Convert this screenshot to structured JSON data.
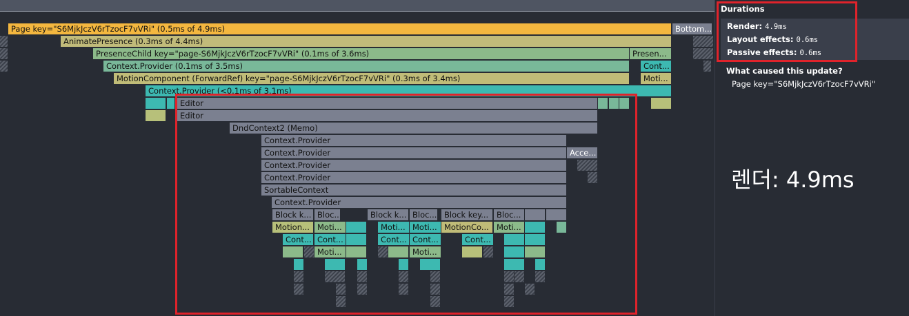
{
  "flamegraph": {
    "rows": [
      [
        {
          "label": "Page key=\"S6MjkJczV6rTzocF7vVRi\" (0.5ms of 4.9ms)",
          "color": "#f4b73f"
        },
        {
          "label": "Bottom...",
          "color": "#7b8090"
        }
      ],
      [
        {
          "label": "AnimatePresence (0.3ms of 4.4ms)",
          "color": "#c1bb7a"
        }
      ],
      [
        {
          "label": "PresenceChild key=\"page-S6MjkJczV6rTzocF7vVRi\" (0.1ms of 3.6ms)",
          "color": "#8cba8a"
        },
        {
          "label": "Presen...",
          "color": "#8cba8a"
        }
      ],
      [
        {
          "label": "Context.Provider (0.1ms of 3.5ms)",
          "color": "#79b899"
        },
        {
          "label": "Cont...",
          "color": "#3db9b1"
        }
      ],
      [
        {
          "label": "MotionComponent (ForwardRef) key=\"page-S6MjkJczV6rTzocF7vVRi\" (0.3ms of 3.4ms)",
          "color": "#c0bc78"
        },
        {
          "label": "Moti...",
          "color": "#c0bc78"
        }
      ],
      [
        {
          "label": "Context.Provider (<0.1ms of 3.1ms)",
          "color": "#3db9b1"
        }
      ],
      [
        {
          "label": "Editor",
          "color": "#7b8090"
        }
      ],
      [
        {
          "label": "Editor",
          "color": "#7b8090"
        }
      ],
      [
        {
          "label": "DndContext2 (Memo)",
          "color": "#7b8090"
        }
      ],
      [
        {
          "label": "Context.Provider",
          "color": "#7b8090"
        }
      ],
      [
        {
          "label": "Context.Provider",
          "color": "#7b8090"
        },
        {
          "label": "Acce...",
          "color": "#7b8090"
        }
      ],
      [
        {
          "label": "Context.Provider",
          "color": "#7b8090"
        }
      ],
      [
        {
          "label": "Context.Provider",
          "color": "#7b8090"
        }
      ],
      [
        {
          "label": "SortableContext",
          "color": "#7b8090"
        }
      ],
      [
        {
          "label": "Context.Provider",
          "color": "#7b8090"
        }
      ],
      [
        {
          "label": "Block k...",
          "color": "#7b8090"
        },
        {
          "label": "Bloc...",
          "color": "#7b8090"
        },
        {
          "label": "Block k...",
          "color": "#7b8090"
        },
        {
          "label": "Bloc...",
          "color": "#7b8090"
        },
        {
          "label": "Block key...",
          "color": "#7b8090"
        },
        {
          "label": "Bloc...",
          "color": "#7b8090"
        }
      ],
      [
        {
          "label": "Motion...",
          "color": "#b7c07a"
        },
        {
          "label": "Moti...",
          "color": "#8cba8a"
        },
        {
          "label": "Moti...",
          "color": "#3db9b1"
        },
        {
          "label": "Moti...",
          "color": "#3db9b1"
        },
        {
          "label": "MotionCo...",
          "color": "#c0bc78"
        },
        {
          "label": "Moti...",
          "color": "#8cba8a"
        }
      ],
      [
        {
          "label": "Cont...",
          "color": "#3db9b1"
        },
        {
          "label": "Cont...",
          "color": "#3db9b1"
        },
        {
          "label": "Cont...",
          "color": "#3db9b1"
        },
        {
          "label": "Cont...",
          "color": "#3db9b1"
        },
        {
          "label": "Cont...",
          "color": "#3db9b1"
        }
      ],
      [
        {
          "label": "Moti...",
          "color": "#8cba8a"
        },
        {
          "label": "Moti...",
          "color": "#8cba8a"
        }
      ]
    ]
  },
  "sidebar": {
    "durations_title": "Durations",
    "render_label": "Render:",
    "render_value": "4.9ms",
    "layout_label": "Layout effects:",
    "layout_value": "0.6ms",
    "passive_label": "Passive effects:",
    "passive_value": "0.6ms",
    "cause_title": "What caused this update?",
    "cause_item": "Page key=\"S6MjkJczV6rTzocF7vVRi\""
  },
  "annotation": {
    "text": "렌더: 4.9ms"
  },
  "colors": {
    "highlight": "#e0232b",
    "background": "#282c34"
  }
}
